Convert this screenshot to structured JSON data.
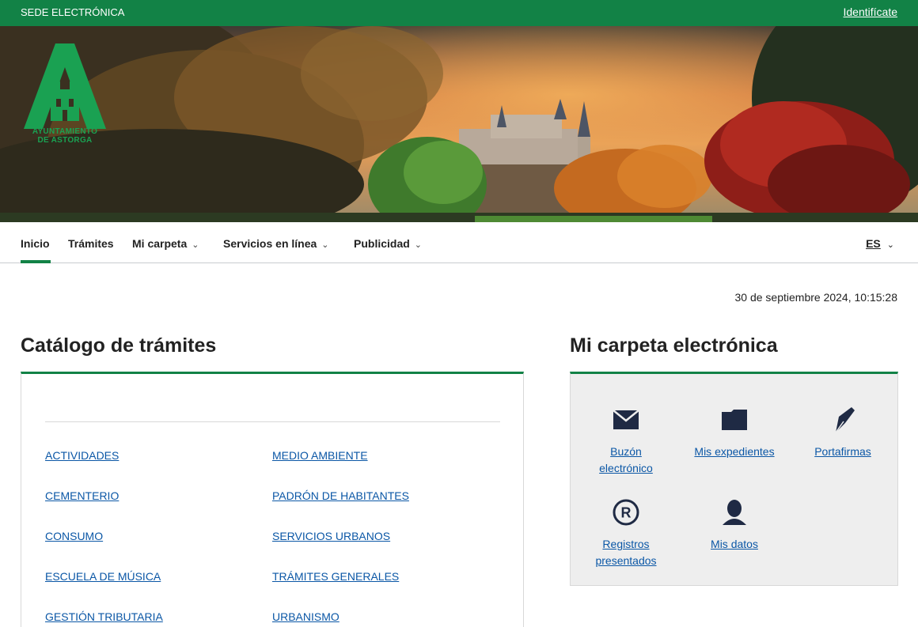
{
  "topbar": {
    "title": "SEDE ELECTRÓNICA",
    "login": "Identifícate"
  },
  "logo": {
    "line1": "AYUNTAMIENTO",
    "line2": "DE ASTORGA"
  },
  "nav": {
    "items": [
      {
        "label": "Inicio",
        "dropdown": false,
        "active": true
      },
      {
        "label": "Trámites",
        "dropdown": false
      },
      {
        "label": "Mi carpeta",
        "dropdown": true
      },
      {
        "label": "Servicios en línea",
        "dropdown": true
      },
      {
        "label": "Publicidad",
        "dropdown": true
      }
    ],
    "language": "ES"
  },
  "datetime": "30 de septiembre 2024, 10:15:28",
  "catalog": {
    "title": "Catálogo de trámites",
    "left_links": [
      "ACTIVIDADES",
      "CEMENTERIO",
      "CONSUMO",
      "ESCUELA DE MÚSICA",
      "GESTIÓN TRIBUTARIA"
    ],
    "right_links": [
      "MEDIO AMBIENTE",
      "PADRÓN DE HABITANTES",
      "SERVICIOS URBANOS",
      "TRÁMITES GENERALES",
      "URBANISMO"
    ]
  },
  "carpeta": {
    "title": "Mi carpeta electrónica",
    "items": [
      {
        "label_1": "Buzón",
        "label_2": "electrónico",
        "icon": "envelope-icon"
      },
      {
        "label_1": "Mis expedientes",
        "icon": "folder-icon"
      },
      {
        "label_1": "Portafirmas",
        "icon": "pen-nib-icon"
      },
      {
        "label_1": "Registros",
        "label_2": "presentados",
        "icon": "registered-icon"
      },
      {
        "label_1": "Mis datos",
        "icon": "user-icon"
      }
    ]
  },
  "colors": {
    "brand_green": "#128246",
    "link_blue": "#0b57a6",
    "icon_dark": "#1f2a44"
  }
}
